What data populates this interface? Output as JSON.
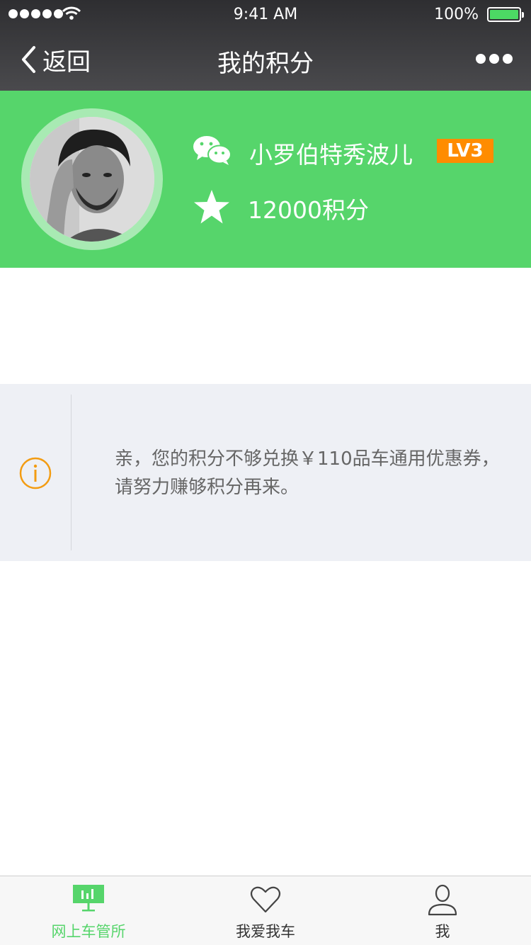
{
  "status_bar": {
    "time": "9:41 AM",
    "battery": "100%",
    "battery_level": 1.0
  },
  "nav": {
    "back_label": "返回",
    "title": "我的积分"
  },
  "profile": {
    "username": "小罗伯特秀波儿",
    "level": "LV3",
    "points": "12000积分"
  },
  "notice": {
    "text": "亲，您的积分不够兑换￥110品车通用优惠券，请努力赚够积分再来。"
  },
  "tabs": [
    {
      "label": "网上车管所",
      "icon": "dashboard-icon",
      "active": true
    },
    {
      "label": "我爱我车",
      "icon": "heart-icon",
      "active": false
    },
    {
      "label": "我",
      "icon": "person-icon",
      "active": false
    }
  ],
  "colors": {
    "accent_green": "#56d56b",
    "level_badge": "#ff8c00",
    "info_icon": "#f39c12"
  }
}
